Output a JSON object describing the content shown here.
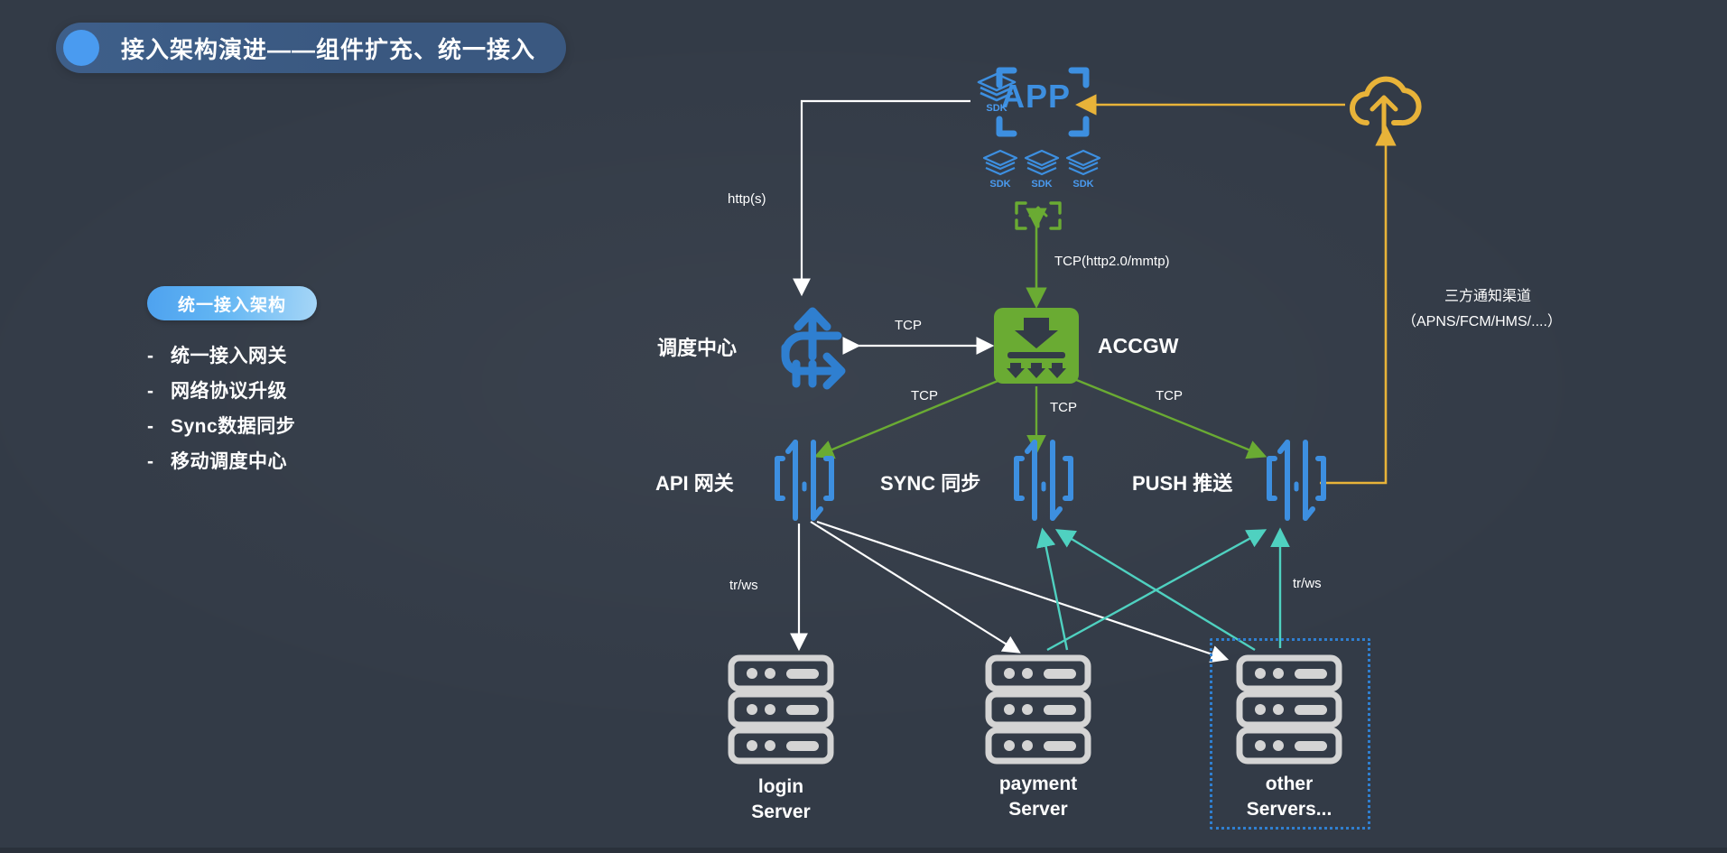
{
  "header": {
    "title": "接入架构演进——组件扩充、统一接入",
    "dot_icon": "circle-icon",
    "pill_color": "#3a5880",
    "dot_color": "#4a9bf0"
  },
  "legend": {
    "badge_label": "统一接入架构",
    "badge_gradient_from": "#4ea2ef",
    "badge_gradient_to": "#a6d6f7",
    "bullet_marker": "-",
    "items": [
      {
        "label": "统一接入网关"
      },
      {
        "label": "网络协议升级"
      },
      {
        "label": "Sync数据同步"
      },
      {
        "label": "移动调度中心"
      }
    ]
  },
  "diagram": {
    "nodes": {
      "app": {
        "label": "APP",
        "icon": "app-frame-icon",
        "sdk_badge": "SDK",
        "sdk_stack_icon": "sdk-layers-icon",
        "color": "#3d8fe0"
      },
      "sdk_row": {
        "items": [
          "SDK",
          "SDK",
          "SDK"
        ],
        "icon": "sdk-layers-icon",
        "color": "#3d8fe0"
      },
      "uplink_box": {
        "icon": "upload-arrow-box-icon",
        "color": "#6aae2e"
      },
      "dispatch_center": {
        "label": "调度中心",
        "icon": "traffic-routing-icon",
        "color": "#2f7fd0"
      },
      "accgw": {
        "label": "ACCGW",
        "icon": "gateway-fanout-icon",
        "color": "#6aab33"
      },
      "api_gateway": {
        "label": "API 网关",
        "icon": "gateway-icon",
        "color": "#3d8fe0"
      },
      "sync": {
        "label": "SYNC 同步",
        "icon": "gateway-icon",
        "color": "#3d8fe0"
      },
      "push": {
        "label": "PUSH 推送",
        "icon": "gateway-icon",
        "color": "#3d8fe0"
      },
      "cloud": {
        "icon": "cloud-upload-icon",
        "color": "#e8b339",
        "caption_line1": "三方通知渠道",
        "caption_line2": "（APNS/FCM/HMS/....）"
      },
      "login_server": {
        "caption_line1": "login",
        "caption_line2": "Server",
        "icon": "server-rack-icon",
        "color": "#d4d4d4"
      },
      "payment_server": {
        "caption_line1": "payment",
        "caption_line2": "Server",
        "icon": "server-rack-icon",
        "color": "#d4d4d4"
      },
      "other_servers": {
        "caption_line1": "other",
        "caption_line2": "Servers...",
        "icon": "server-rack-icon",
        "color": "#d4d4d4",
        "highlight_border": "#2f7fd0"
      }
    },
    "edge_labels": {
      "http": "http(s)",
      "tcp_app_accgw": "TCP(http2.0/mmtp)",
      "tcp_dispatch": "TCP",
      "tcp_api": "TCP",
      "tcp_sync": "TCP",
      "tcp_push": "TCP",
      "trws_left": "tr/ws",
      "trws_right": "tr/ws"
    },
    "edge_colors": {
      "white": "#ffffff",
      "green": "#6aab33",
      "teal": "#4fd1c0",
      "orange": "#e8b339"
    }
  }
}
